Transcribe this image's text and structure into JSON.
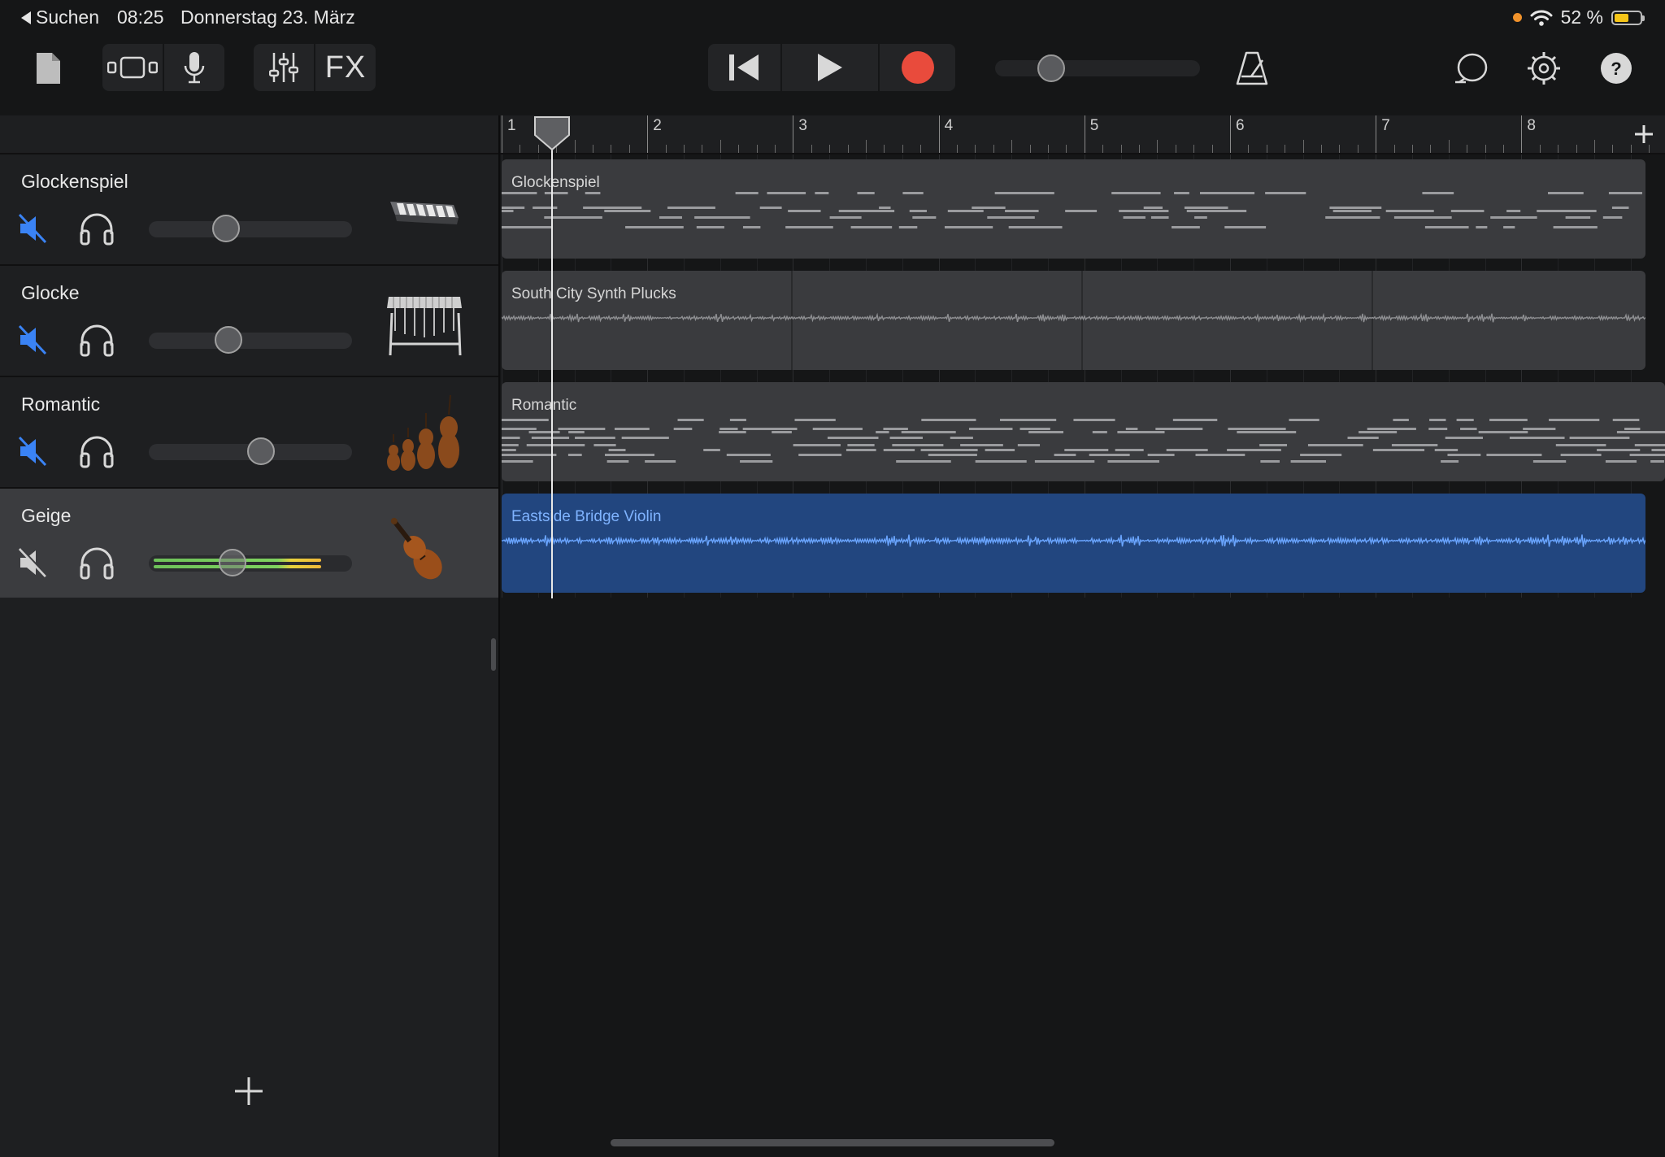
{
  "status_bar": {
    "back_label": "Suchen",
    "time": "08:25",
    "date": "Donnerstag 23. März",
    "battery": "52 %"
  },
  "toolbar": {
    "fx_label": "FX",
    "record_color": "#e94b3c"
  },
  "ruler": {
    "bars": [
      "1",
      "2",
      "3",
      "4",
      "5",
      "6",
      "7",
      "8"
    ]
  },
  "tracks": [
    {
      "name": "Glockenspiel",
      "icon": "glockenspiel-icon",
      "muted": true,
      "volume": 0.38
    },
    {
      "name": "Glocke",
      "icon": "vibraphone-icon",
      "muted": true,
      "volume": 0.39
    },
    {
      "name": "Romantic",
      "icon": "string-ensemble-icon",
      "muted": true,
      "volume": 0.55
    },
    {
      "name": "Geige",
      "icon": "violin-icon",
      "muted": false,
      "volume": 0.41,
      "selected": true
    }
  ],
  "regions": [
    {
      "name": "Glockenspiel",
      "type": "midi"
    },
    {
      "name": "South City Synth Plucks",
      "type": "audio"
    },
    {
      "name": "Romantic",
      "type": "midi"
    },
    {
      "name": "Eastside Bridge Violin",
      "type": "audio",
      "selected": true
    }
  ],
  "colors": {
    "mute_active": "#3a83f5",
    "region_selected": "#22467f",
    "waveform_selected": "#6aa5ff"
  }
}
